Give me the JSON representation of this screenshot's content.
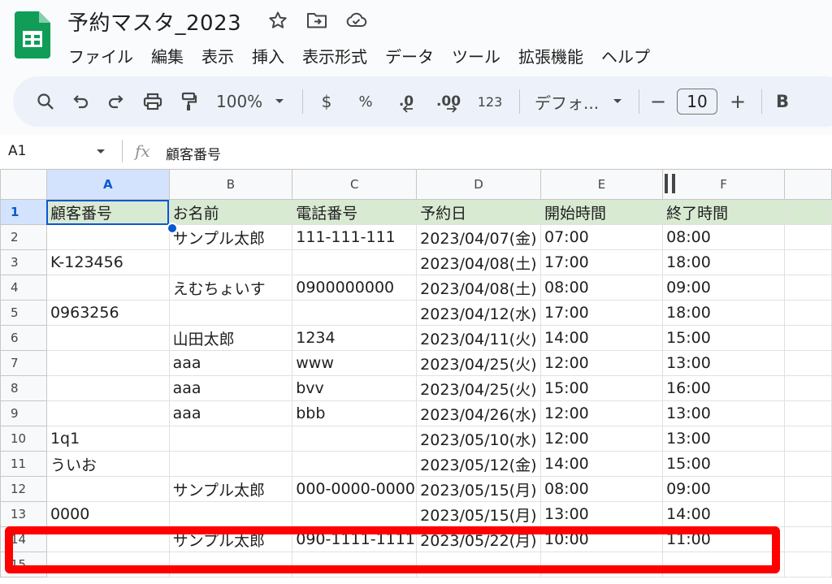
{
  "document": {
    "title": "予約マスタ_2023"
  },
  "menu": [
    "ファイル",
    "編集",
    "表示",
    "挿入",
    "表示形式",
    "データ",
    "ツール",
    "拡張機能",
    "ヘルプ"
  ],
  "toolbar": {
    "zoom": "100%",
    "currency": "$",
    "percent": "%",
    "decrease_decimal": ".0",
    "increase_decimal": ".00",
    "number_format": "123",
    "font": "デフォ...",
    "font_size": "10",
    "minus": "−",
    "plus": "+",
    "bold": "B"
  },
  "formula_bar": {
    "cell_ref": "A1",
    "fx": "fx",
    "value": "顧客番号"
  },
  "columns": [
    "A",
    "B",
    "C",
    "D",
    "E",
    "F"
  ],
  "rows": [
    {
      "num": "1",
      "cells": [
        "顧客番号",
        "お名前",
        "電話番号",
        "予約日",
        "開始時間",
        "終了時間"
      ]
    },
    {
      "num": "2",
      "cells": [
        "",
        "サンプル太郎",
        "111-111-111",
        "2023/04/07(金)",
        "07:00",
        "08:00"
      ]
    },
    {
      "num": "3",
      "cells": [
        "K-123456",
        "",
        "",
        "2023/04/08(土)",
        "17:00",
        "18:00"
      ]
    },
    {
      "num": "4",
      "cells": [
        "",
        "えむちょいす",
        "0900000000",
        "2023/04/08(土)",
        "08:00",
        "09:00"
      ]
    },
    {
      "num": "5",
      "cells": [
        "0963256",
        "",
        "",
        "2023/04/12(水)",
        "17:00",
        "18:00"
      ]
    },
    {
      "num": "6",
      "cells": [
        "",
        "山田太郎",
        "1234",
        "2023/04/11(火)",
        "14:00",
        "15:00"
      ]
    },
    {
      "num": "7",
      "cells": [
        "",
        "aaa",
        "www",
        "2023/04/25(火)",
        "12:00",
        "13:00"
      ]
    },
    {
      "num": "8",
      "cells": [
        "",
        "aaa",
        "bvv",
        "2023/04/25(火)",
        "15:00",
        "16:00"
      ]
    },
    {
      "num": "9",
      "cells": [
        "",
        "aaa",
        "bbb",
        "2023/04/26(水)",
        "12:00",
        "13:00"
      ]
    },
    {
      "num": "10",
      "cells": [
        "1q1",
        "",
        "",
        "2023/05/10(水)",
        "12:00",
        "13:00"
      ]
    },
    {
      "num": "11",
      "cells": [
        "ういお",
        "",
        "",
        "2023/05/12(金)",
        "14:00",
        "15:00"
      ]
    },
    {
      "num": "12",
      "cells": [
        "",
        "サンプル太郎",
        "000-0000-0000",
        "2023/05/15(月)",
        "08:00",
        "09:00"
      ]
    },
    {
      "num": "13",
      "cells": [
        "0000",
        "",
        "",
        "2023/05/15(月)",
        "13:00",
        "14:00"
      ]
    },
    {
      "num": "14",
      "cells": [
        "",
        "サンプル太郎",
        "090-1111-1111",
        "2023/05/22(月)",
        "10:00",
        "11:00"
      ]
    },
    {
      "num": "15",
      "cells": [
        "",
        "",
        "",
        "",
        "",
        ""
      ]
    }
  ],
  "colors": {
    "header_row_fill": "#d9ead3",
    "selection": "#0b57d0",
    "highlight_box": "#ff0000"
  }
}
